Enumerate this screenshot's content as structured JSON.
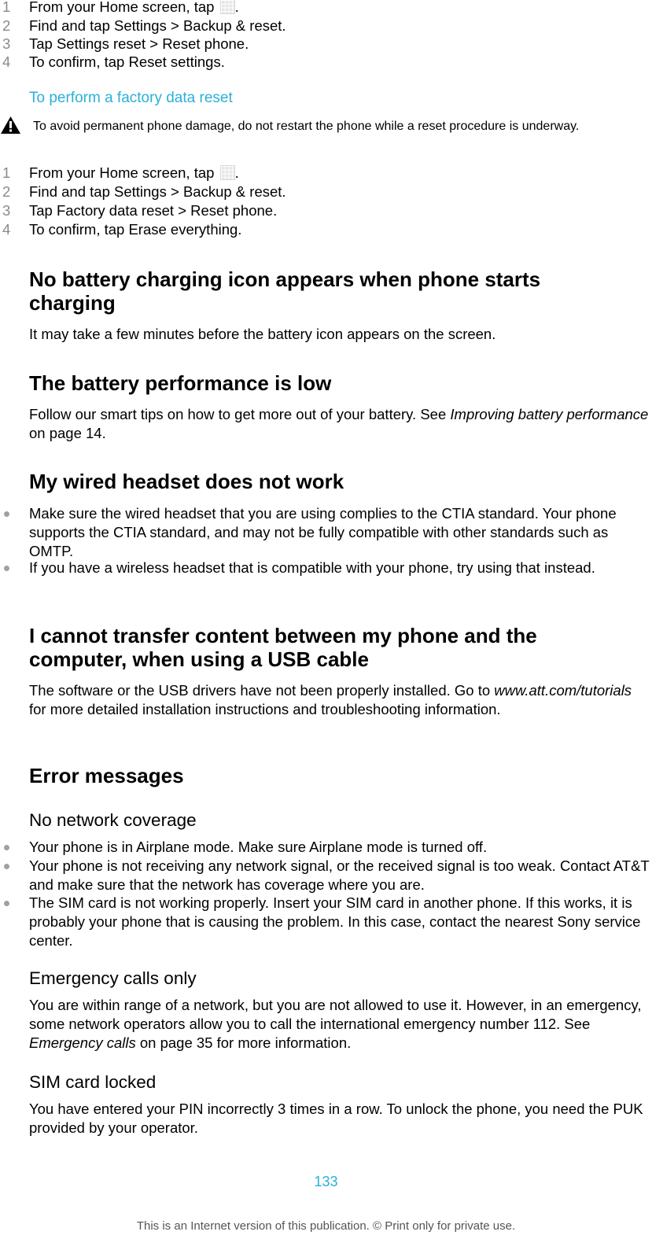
{
  "reset_settings_steps": [
    {
      "num": "1",
      "pre": "From your Home screen, tap ",
      "icon": "apps-grid-icon",
      "post": "."
    },
    {
      "num": "2",
      "pre": "Find and tap ",
      "b1": "Settings",
      "mid": " > ",
      "b2": "Backup & reset",
      "post": "."
    },
    {
      "num": "3",
      "pre": "Tap ",
      "b1": "Settings reset",
      "mid": " > ",
      "b2": "Reset phone",
      "post": "."
    },
    {
      "num": "4",
      "pre": "To confirm, tap ",
      "b1": "Reset settings",
      "post": "."
    }
  ],
  "factory_reset": {
    "title": "To perform a factory data reset",
    "warning_icon": "warning-triangle-icon",
    "warning": "To avoid permanent phone damage, do not restart the phone while a reset procedure is underway.",
    "steps": [
      {
        "num": "1",
        "pre": "From your Home screen, tap ",
        "icon": "apps-grid-icon",
        "post": "."
      },
      {
        "num": "2",
        "pre": "Find and tap ",
        "b1": "Settings",
        "mid": " > ",
        "b2": "Backup & reset",
        "post": "."
      },
      {
        "num": "3",
        "pre": "Tap ",
        "b1": "Factory data reset",
        "mid": " > ",
        "b2": "Reset phone",
        "post": "."
      },
      {
        "num": "4",
        "pre": "To confirm, tap ",
        "b1": "Erase everything",
        "post": "."
      }
    ]
  },
  "sections": {
    "no_charging_icon": {
      "heading": "No battery charging icon appears when phone starts charging",
      "body": "It may take a few minutes before the battery icon appears on the screen."
    },
    "battery_low": {
      "heading": "The battery performance is low",
      "body_pre": "Follow our smart tips on how to get more out of your battery. See ",
      "body_link": "Improving battery performance",
      "body_post": " on page 14."
    },
    "headset": {
      "heading": "My wired headset does not work",
      "bullets": [
        "Make sure the wired headset that you are using complies to the CTIA standard. Your phone supports the CTIA standard, and may not be fully compatible with other standards such as OMTP.",
        "If you have a wireless headset that is compatible with your phone, try using that instead."
      ]
    },
    "usb": {
      "heading": "I cannot transfer content between my phone and the computer, when using a USB cable",
      "body_pre": "The software or the USB drivers have not been properly installed. Go to ",
      "body_link": "www.att.com/tutorials",
      "body_post": " for more detailed installation instructions and troubleshooting information."
    },
    "error_messages": {
      "heading": "Error messages",
      "no_network": {
        "heading": "No network coverage",
        "bullets": [
          "Your phone is in Airplane mode. Make sure Airplane mode is turned off.",
          "Your phone is not receiving any network signal, or the received signal is too weak. Contact AT&T and make sure that the network has coverage where you are.",
          "The SIM card is not working properly. Insert your SIM card in another phone. If this works, it is probably your phone that is causing the problem. In this case, contact the nearest Sony service center."
        ]
      },
      "emergency_only": {
        "heading": "Emergency calls only",
        "body_pre": "You are within range of a network, but you are not allowed to use it. However, in an emergency, some network operators allow you to call the international emergency number 112. See ",
        "body_link": "Emergency calls",
        "body_post": " on page 35 for more information."
      },
      "sim_locked": {
        "heading": "SIM card locked",
        "body": "You have entered your PIN incorrectly 3 times in a row. To unlock the phone, you need the PUK provided by your operator."
      }
    }
  },
  "page_number": "133",
  "footer": "This is an Internet version of this publication. © Print only for private use.",
  "colors": {
    "accent": "#2ab0d8",
    "step_number": "#8a8a8a",
    "bullet": "#a0a0a0"
  }
}
